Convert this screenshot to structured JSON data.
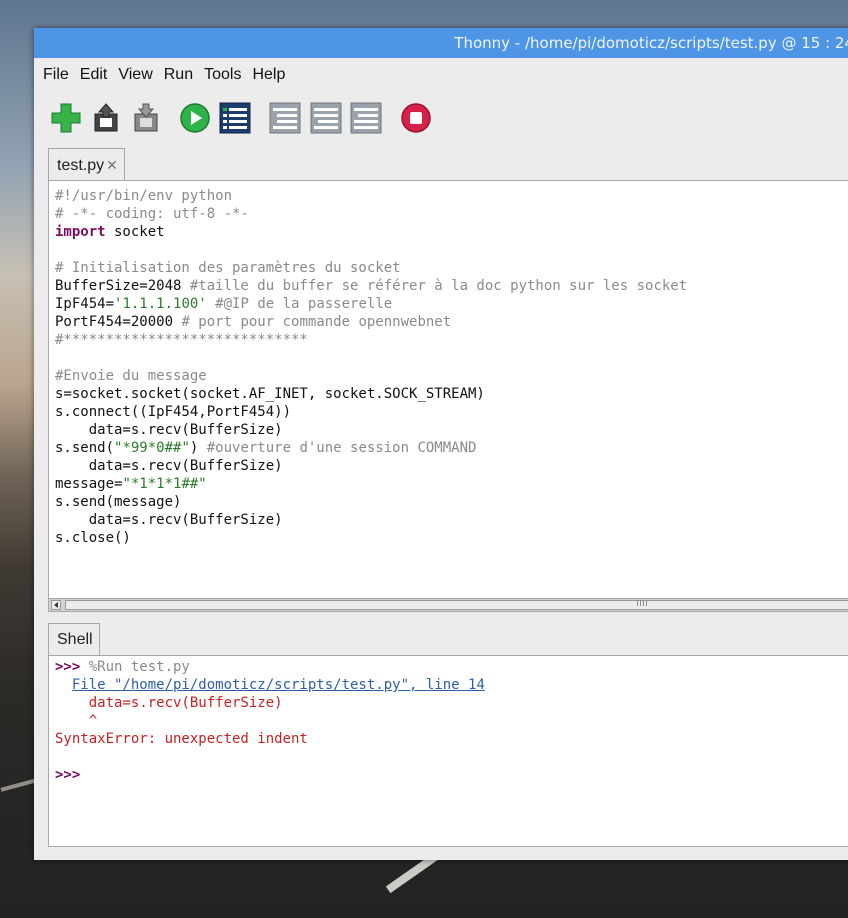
{
  "window": {
    "title": "Thonny  -  /home/pi/domoticz/scripts/test.py  @  15 : 24"
  },
  "menu": [
    "File",
    "Edit",
    "View",
    "Run",
    "Tools",
    "Help"
  ],
  "toolbar": {
    "icons": [
      "new-file-icon",
      "load-file-icon",
      "save-file-icon",
      "run-icon",
      "debug-icon",
      "step-over-icon",
      "step-into-icon",
      "step-out-icon",
      "stop-icon"
    ],
    "colors": {
      "new": "#37b34a",
      "run": "#2db34a",
      "stop": "#d4224a"
    }
  },
  "editor": {
    "tab_label": "test.py",
    "tab_close": "✕",
    "lines": [
      {
        "segments": [
          {
            "t": "#!/usr/bin/env python",
            "c": "cm"
          }
        ]
      },
      {
        "segments": [
          {
            "t": "# -*- coding: utf-8 -*-",
            "c": "cm"
          }
        ]
      },
      {
        "segments": [
          {
            "t": "import",
            "c": "kw"
          },
          {
            "t": " socket",
            "c": ""
          }
        ]
      },
      {
        "segments": []
      },
      {
        "segments": [
          {
            "t": "# Initialisation des paramètres du socket",
            "c": "cm"
          }
        ]
      },
      {
        "segments": [
          {
            "t": "BufferSize=2048 ",
            "c": ""
          },
          {
            "t": "#taille du buffer se référer à la doc python sur les socket",
            "c": "cm"
          }
        ]
      },
      {
        "segments": [
          {
            "t": "IpF454=",
            "c": ""
          },
          {
            "t": "'1.1.1.100'",
            "c": "st"
          },
          {
            "t": " ",
            "c": ""
          },
          {
            "t": "#@IP de la passerelle",
            "c": "cm"
          }
        ]
      },
      {
        "segments": [
          {
            "t": "PortF454=20000 ",
            "c": ""
          },
          {
            "t": "# port pour commande opennwebnet",
            "c": "cm"
          }
        ]
      },
      {
        "segments": [
          {
            "t": "#*****************************",
            "c": "cm"
          }
        ]
      },
      {
        "segments": []
      },
      {
        "segments": [
          {
            "t": "#Envoie du message",
            "c": "cm"
          }
        ]
      },
      {
        "segments": [
          {
            "t": "s=socket.socket(socket.AF_INET, socket.SOCK_STREAM)",
            "c": ""
          }
        ]
      },
      {
        "segments": [
          {
            "t": "s.connect((IpF454,PortF454))",
            "c": ""
          }
        ]
      },
      {
        "segments": [
          {
            "t": "    data=s.recv(BufferSize)",
            "c": ""
          }
        ]
      },
      {
        "segments": [
          {
            "t": "s.send(",
            "c": ""
          },
          {
            "t": "\"*99*0##\"",
            "c": "st"
          },
          {
            "t": ") ",
            "c": ""
          },
          {
            "t": "#ouverture d'une session COMMAND",
            "c": "cm"
          }
        ]
      },
      {
        "segments": [
          {
            "t": "    data=s.recv(BufferSize)",
            "c": ""
          }
        ]
      },
      {
        "segments": [
          {
            "t": "message=",
            "c": ""
          },
          {
            "t": "\"*1*1*1##\"",
            "c": "st"
          }
        ]
      },
      {
        "segments": [
          {
            "t": "s.send(message)",
            "c": ""
          }
        ]
      },
      {
        "segments": [
          {
            "t": "    data=s.recv(BufferSize)",
            "c": ""
          }
        ]
      },
      {
        "segments": [
          {
            "t": "s.close()",
            "c": ""
          }
        ]
      }
    ]
  },
  "shell": {
    "tab_label": "Shell",
    "lines": [
      {
        "segments": [
          {
            "t": ">>> ",
            "c": "prompt"
          },
          {
            "t": "%Run test.py",
            "c": "cm"
          }
        ]
      },
      {
        "segments": [
          {
            "t": "  ",
            "c": ""
          },
          {
            "t": "File \"/home/pi/domoticz/scripts/test.py\", line 14",
            "c": "link"
          }
        ]
      },
      {
        "segments": [
          {
            "t": "    data=s.recv(BufferSize)",
            "c": "err"
          }
        ]
      },
      {
        "segments": [
          {
            "t": "    ^",
            "c": "err"
          }
        ]
      },
      {
        "segments": [
          {
            "t": "SyntaxError: unexpected indent",
            "c": "err"
          }
        ]
      },
      {
        "segments": []
      },
      {
        "segments": [
          {
            "t": ">>> ",
            "c": "prompt"
          }
        ]
      }
    ]
  }
}
